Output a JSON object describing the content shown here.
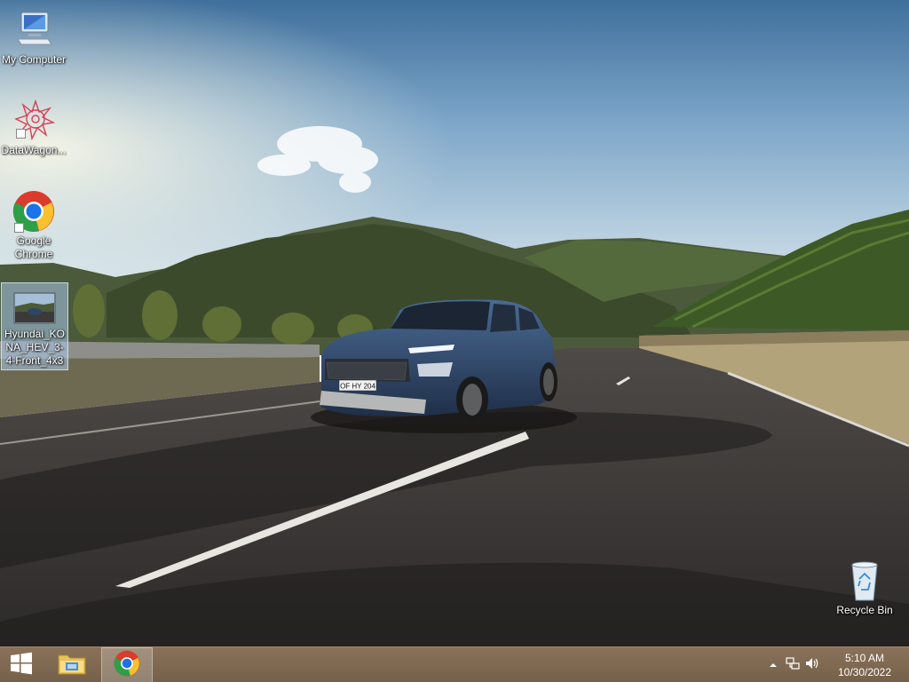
{
  "desktop": {
    "icons": [
      {
        "label": "My Computer",
        "icon": "computer-icon"
      },
      {
        "label": "DataWagon...",
        "icon": "datawagon-icon"
      },
      {
        "label": "Google Chrome",
        "icon": "chrome-icon"
      },
      {
        "label": "Hyundai_KONA_HEV_3-4-Front_4x3",
        "icon": "image-file-icon"
      },
      {
        "label": "Recycle Bin",
        "icon": "recycle-bin-icon"
      }
    ],
    "wallpaper": {
      "license_plate": "OF HY 204"
    }
  },
  "taskbar": {
    "items": [
      {
        "name": "start-button",
        "icon": "windows-logo-icon"
      },
      {
        "name": "file-explorer",
        "icon": "folder-icon"
      },
      {
        "name": "google-chrome",
        "icon": "chrome-icon",
        "active": true
      }
    ],
    "tray": {
      "icons": [
        "chevron-up-icon",
        "network-icon",
        "volume-icon"
      ],
      "time": "5:10 AM",
      "date": "10/30/2022"
    }
  },
  "colors": {
    "taskbar": "#7d664e",
    "selection": "#aac8eb",
    "car_body": "#2e4566"
  }
}
